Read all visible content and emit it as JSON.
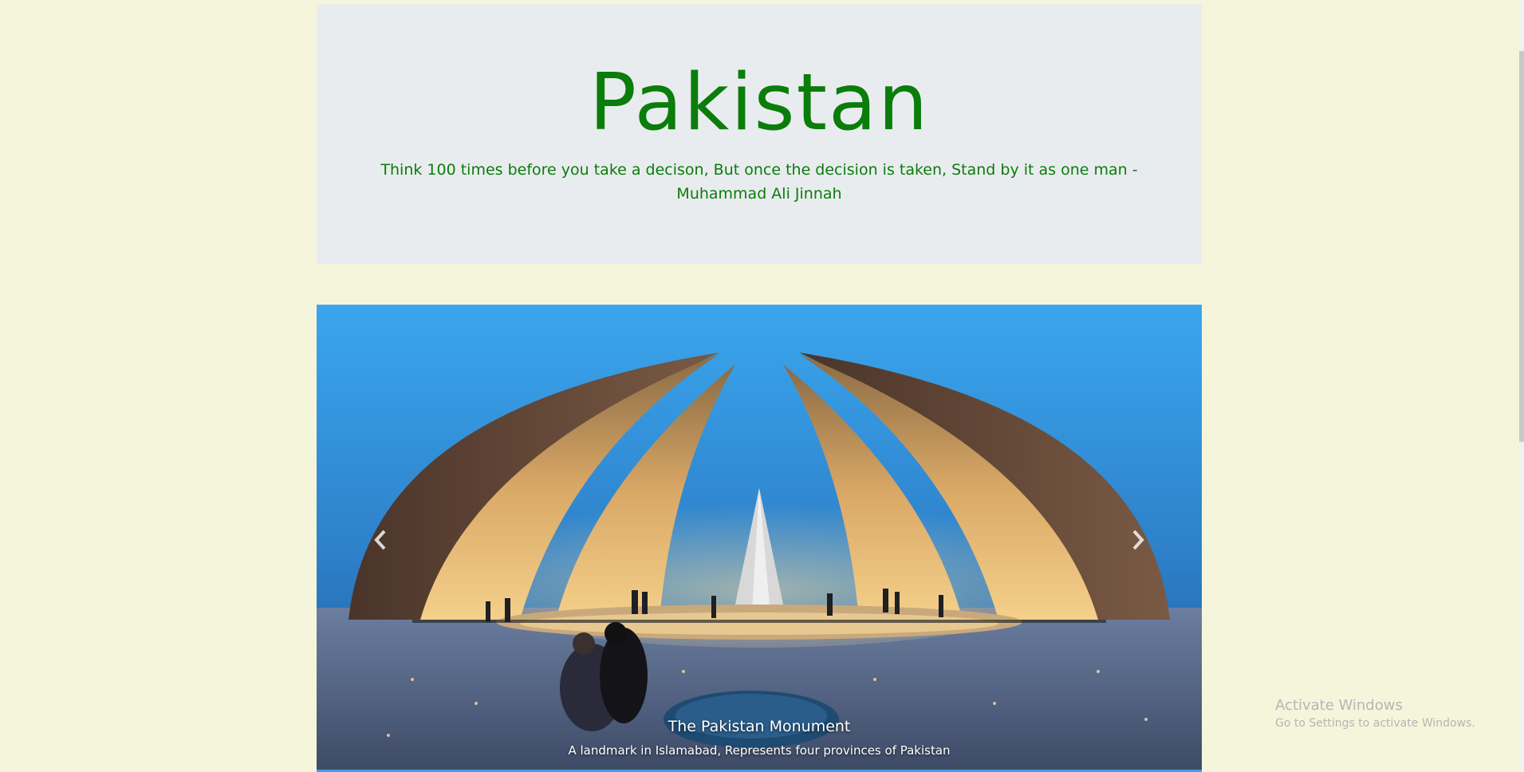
{
  "header": {
    "title": "Pakistan",
    "quote": "Think 100 times before you take a decison, But once the decision is taken, Stand by it as one man - Muhammad Ali Jinnah"
  },
  "carousel": {
    "image_icon": "pakistan-monument-photo",
    "prev_icon": "chevron-left-icon",
    "next_icon": "chevron-right-icon",
    "caption_title": "The Pakistan Monument",
    "caption_text": "A landmark in Islamabad, Represents four provinces of Pakistan"
  },
  "watermark": {
    "title": "Activate Windows",
    "subtitle": "Go to Settings to activate Windows."
  },
  "colors": {
    "page_background": "#f5f5dc",
    "jumbotron_background": "#e9ecef",
    "heading_green": "#0a7d0a"
  }
}
